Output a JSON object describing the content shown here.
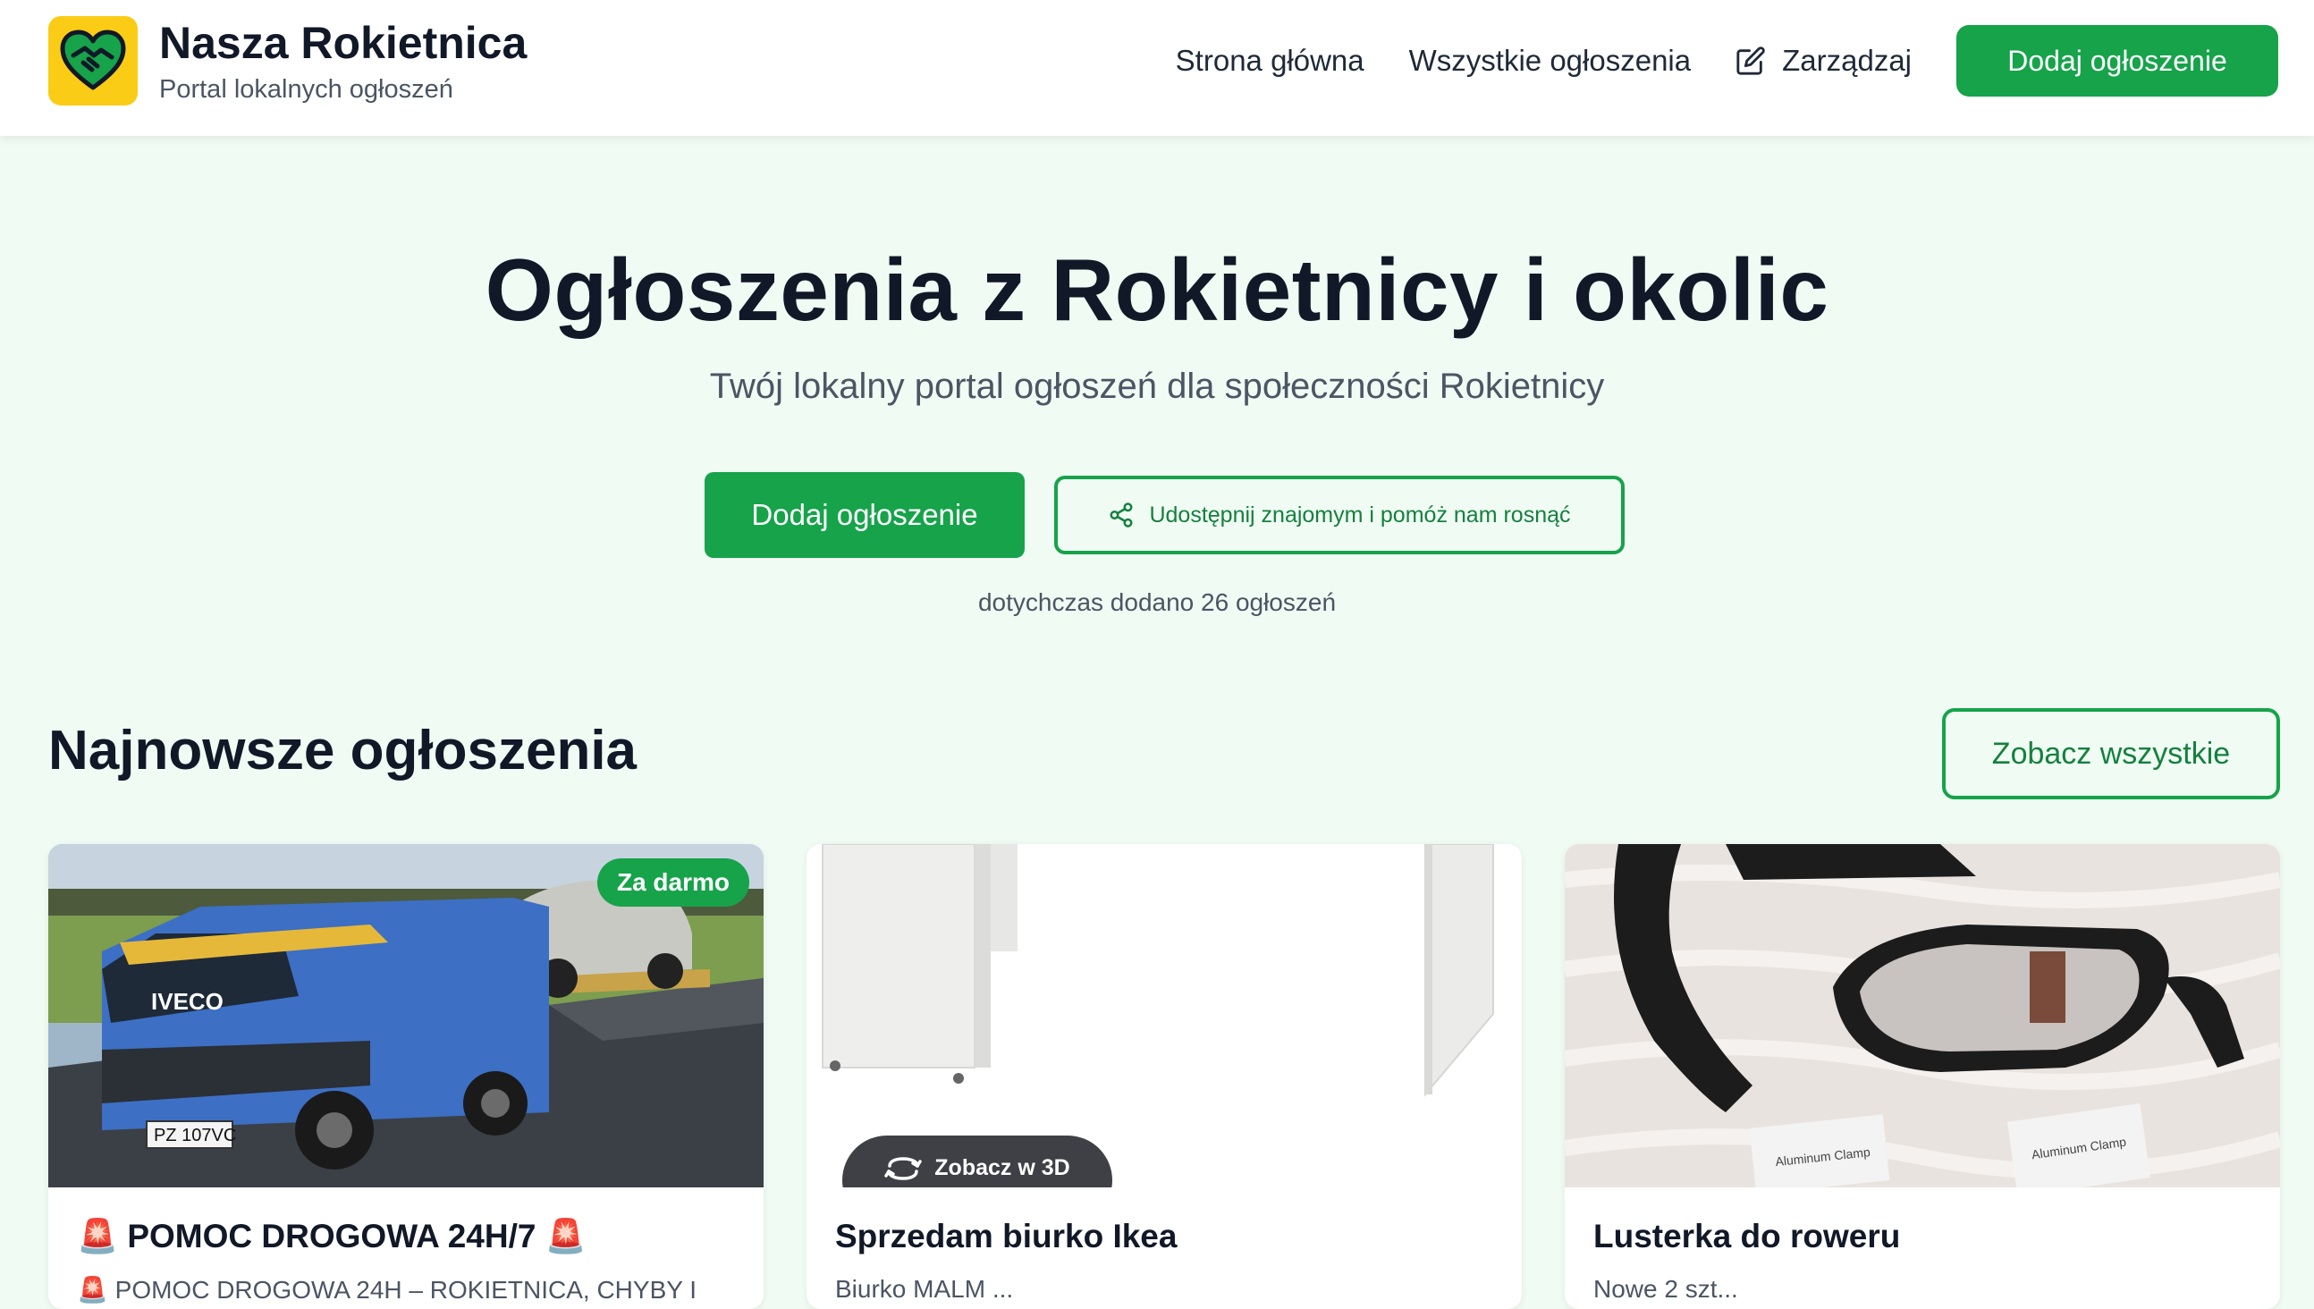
{
  "header": {
    "brand_title": "Nasza Rokietnica",
    "brand_subtitle": "Portal lokalnych ogłoszeń",
    "logo_icon": "heart-handshake-icon",
    "nav": {
      "home": "Strona główna",
      "all_ads": "Wszystkie ogłoszenia",
      "manage": "Zarządzaj",
      "add_ad": "Dodaj ogłoszenie"
    }
  },
  "hero": {
    "title": "Ogłoszenia z Rokietnicy i okolic",
    "subtitle": "Twój lokalny portal ogłoszeń dla społeczności Rokietnicy",
    "add_button": "Dodaj ogłoszenie",
    "share_button": "Udostępnij znajomym i pomóż nam rosnąć",
    "count_text": "dotychczas dodano 26 ogłoszeń"
  },
  "latest": {
    "title": "Najnowsze ogłoszenia",
    "see_all": "Zobacz wszystkie",
    "cards": [
      {
        "title": "🚨 POMOC DROGOWA 24H/7 🚨",
        "badge": "Za darmo",
        "description": "🚨 POMOC DROGOWA 24H – ROKIETNICA, CHYBY I",
        "image": "tow-truck-photo"
      },
      {
        "title": "Sprzedam biurko Ikea",
        "badge_3d": "Zobacz w 3D",
        "description": "Biurko MALM ...",
        "image": "white-desk-photo"
      },
      {
        "title": "Lusterka do roweru",
        "description": "Nowe 2 szt...",
        "image": "bike-mirrors-photo"
      }
    ]
  },
  "colors": {
    "primary": "#16a34a",
    "background": "#f0fbf4",
    "logo_yellow": "#facc15"
  }
}
